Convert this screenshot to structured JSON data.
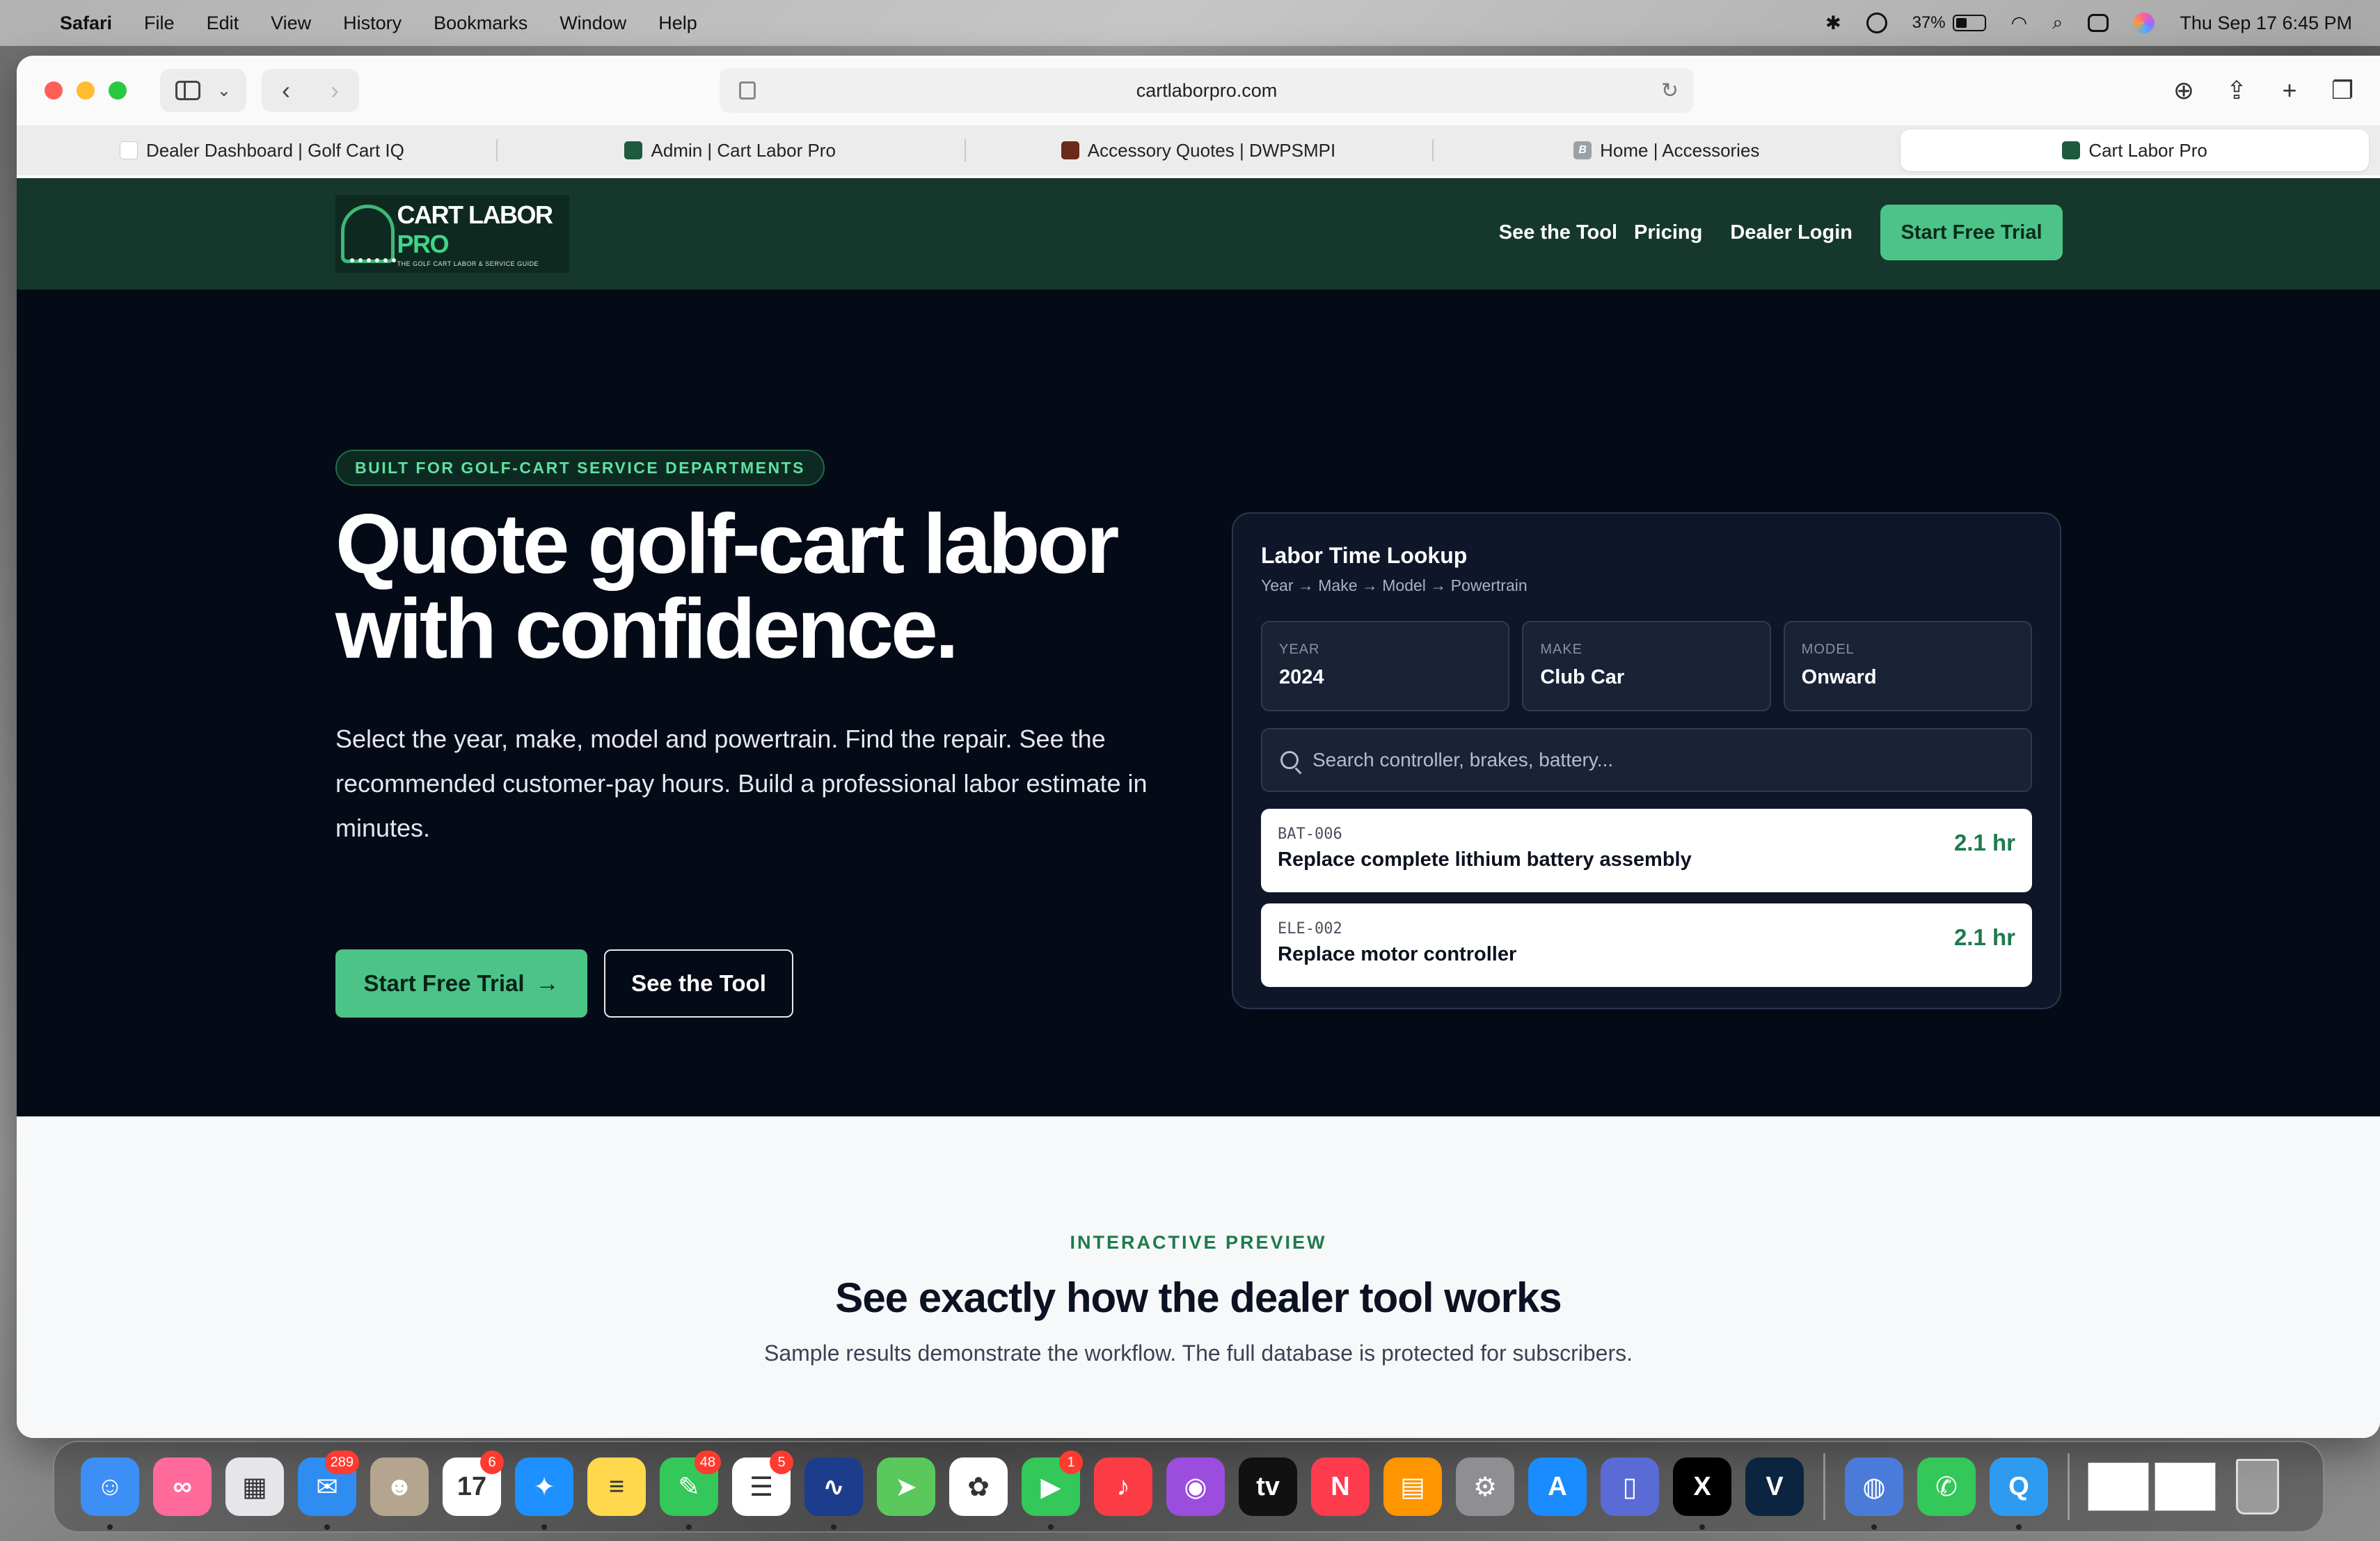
{
  "menubar": {
    "app": "Safari",
    "menus": [
      "File",
      "Edit",
      "View",
      "History",
      "Bookmarks",
      "Window",
      "Help"
    ],
    "battery": "37%",
    "datetime": "Thu Sep 17  6:45 PM"
  },
  "browser": {
    "url": "cartlaborpro.com",
    "tabs": [
      {
        "label": "Dealer Dashboard | Golf Cart IQ",
        "favicon_color": "#ffffff"
      },
      {
        "label": "Admin | Cart Labor Pro",
        "favicon_color": "#1e5a3e"
      },
      {
        "label": "Accessory Quotes | DWPSMPI",
        "favicon_color": "#6b2a1a"
      },
      {
        "label": "Home | Accessories",
        "favicon_color": "#9aa0a6",
        "favicon_letter": "B"
      },
      {
        "label": "Cart Labor Pro",
        "favicon_color": "#1e5a3e"
      }
    ]
  },
  "site": {
    "logo": {
      "brand_a": "CART LABOR",
      "brand_b": "PRO",
      "tagline": "THE GOLF CART LABOR & SERVICE GUIDE"
    },
    "nav": {
      "see_tool": "See the Tool",
      "pricing": "Pricing",
      "login": "Dealer Login",
      "trial": "Start Free Trial"
    },
    "hero": {
      "pill": "BUILT FOR GOLF-CART SERVICE DEPARTMENTS",
      "headline": "Quote golf-cart labor with confidence.",
      "subhead": "Select the year, make, model and powertrain. Find the repair. See the recommended customer-pay hours. Build a professional labor estimate in minutes.",
      "cta_primary": "Start Free Trial",
      "cta_secondary": "See the Tool"
    },
    "lookup": {
      "title": "Labor Time Lookup",
      "breadcrumb": "Year → Make → Model → Powertrain",
      "fields": [
        {
          "label": "YEAR",
          "value": "2024"
        },
        {
          "label": "MAKE",
          "value": "Club Car"
        },
        {
          "label": "MODEL",
          "value": "Onward"
        }
      ],
      "search_placeholder": "Search controller, brakes, battery...",
      "results": [
        {
          "code": "BAT-006",
          "name": "Replace complete lithium battery assembly",
          "hours": "2.1 hr"
        },
        {
          "code": "ELE-002",
          "name": "Replace motor controller",
          "hours": "2.1 hr"
        }
      ]
    },
    "preview": {
      "eyebrow": "INTERACTIVE PREVIEW",
      "title": "See exactly how the dealer tool works",
      "description": "Sample results demonstrate the workflow. The full database is protected for subscribers."
    }
  },
  "dock": {
    "apps": [
      {
        "name": "finder-icon",
        "color": "#3d8ef5",
        "glyph": "☺"
      },
      {
        "name": "infinity-app-icon",
        "color": "#ff6a9a",
        "glyph": "∞"
      },
      {
        "name": "launchpad-icon",
        "color": "#e5e5ea",
        "glyph": "▦"
      },
      {
        "name": "mail-icon",
        "color": "#2f8cf0",
        "glyph": "✉",
        "badge": "289"
      },
      {
        "name": "contacts-icon",
        "color": "#b5a58f",
        "glyph": "☻"
      },
      {
        "name": "calendar-icon",
        "color": "#ffffff",
        "glyph": "17",
        "badge": "6"
      },
      {
        "name": "safari-icon",
        "color": "#1e90ff",
        "glyph": "✦"
      },
      {
        "name": "notes-icon",
        "color": "#ffd84d",
        "glyph": "≡"
      },
      {
        "name": "messages-icon",
        "color": "#34c759",
        "glyph": "✎",
        "badge": "48"
      },
      {
        "name": "reminders-icon",
        "color": "#ffffff",
        "glyph": "☰",
        "badge": "5"
      },
      {
        "name": "freeform-icon",
        "color": "#1c3c8c",
        "glyph": "∿"
      },
      {
        "name": "maps-icon",
        "color": "#5ac85a",
        "glyph": "➤"
      },
      {
        "name": "photos-icon",
        "color": "#ffffff",
        "glyph": "✿"
      },
      {
        "name": "facetime-icon",
        "color": "#34c759",
        "glyph": "▶",
        "badge": "1"
      },
      {
        "name": "music-icon",
        "color": "#fc3c44",
        "glyph": "♪"
      },
      {
        "name": "podcasts-icon",
        "color": "#9b4dde",
        "glyph": "◉"
      },
      {
        "name": "appletv-icon",
        "color": "#111111",
        "glyph": "tv"
      },
      {
        "name": "news-icon",
        "color": "#ff3b4e",
        "glyph": "N"
      },
      {
        "name": "books-icon",
        "color": "#ff9500",
        "glyph": "▤"
      },
      {
        "name": "system-settings-icon",
        "color": "#8e8e93",
        "glyph": "⚙"
      },
      {
        "name": "app-store-icon",
        "color": "#1a8cff",
        "glyph": "A"
      },
      {
        "name": "iphone-mirroring-icon",
        "color": "#5a6bd6",
        "glyph": "▯"
      },
      {
        "name": "x-icon",
        "color": "#000000",
        "glyph": "X"
      },
      {
        "name": "vmx-icon",
        "color": "#0b2540",
        "glyph": "V"
      }
    ],
    "apps2": [
      {
        "name": "robot-app-icon",
        "color": "#4a7bd8",
        "glyph": "◍"
      },
      {
        "name": "phone-icon",
        "color": "#34c759",
        "glyph": "✆"
      },
      {
        "name": "q-app-icon",
        "color": "#2e9bf0",
        "glyph": "Q"
      }
    ]
  }
}
